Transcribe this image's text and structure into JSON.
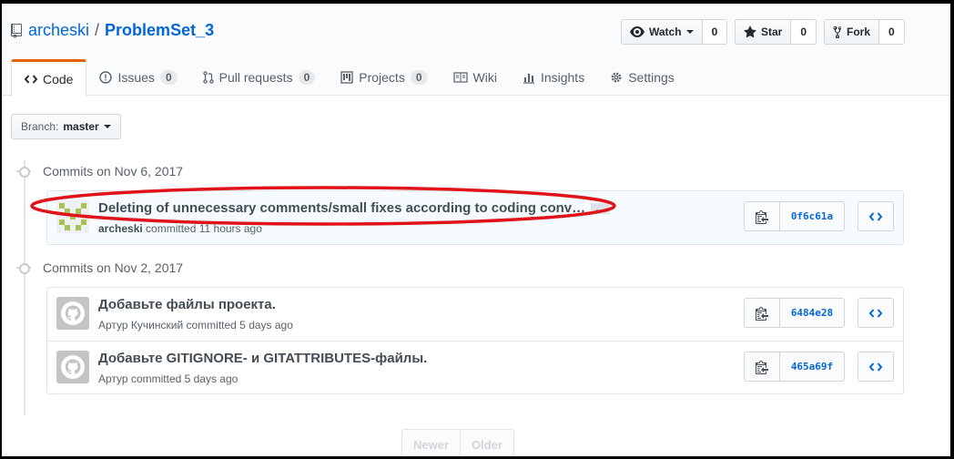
{
  "header": {
    "owner": "archeski",
    "separator": "/",
    "repo": "ProblemSet_3",
    "watch": {
      "label": "Watch",
      "count": "0"
    },
    "star": {
      "label": "Star",
      "count": "0"
    },
    "fork": {
      "label": "Fork",
      "count": "0"
    }
  },
  "tabs": [
    {
      "label": "Code",
      "icon": "code-icon"
    },
    {
      "label": "Issues",
      "count": "0",
      "icon": "issue-icon"
    },
    {
      "label": "Pull requests",
      "count": "0",
      "icon": "pull-request-icon"
    },
    {
      "label": "Projects",
      "count": "0",
      "icon": "project-icon"
    },
    {
      "label": "Wiki",
      "icon": "book-icon"
    },
    {
      "label": "Insights",
      "icon": "graph-icon"
    },
    {
      "label": "Settings",
      "icon": "gear-icon"
    }
  ],
  "branch": {
    "prefix": "Branch:",
    "name": "master"
  },
  "groups": [
    {
      "title": "Commits on Nov 6, 2017",
      "commits": [
        {
          "message": "Deleting of unnecessary comments/small fixes according to coding conv…",
          "ellipsis": "…",
          "author": "archeski",
          "time": "committed 11 hours ago",
          "sha": "0f6c61a"
        }
      ]
    },
    {
      "title": "Commits on Nov 2, 2017",
      "commits": [
        {
          "message": "Добавьте файлы проекта.",
          "author": "Артур Кучинский",
          "time": "committed 5 days ago",
          "sha": "6484e28"
        },
        {
          "message": "Добавьте GITIGNORE- и GITATTRIBUTES-файлы.",
          "author": "Артур",
          "time": "committed 5 days ago",
          "sha": "465a69f"
        }
      ]
    }
  ],
  "pagination": {
    "newer": "Newer",
    "older": "Older"
  },
  "colors": {
    "link": "#0366d6",
    "tab_accent": "#e36209",
    "annotation": "#e0121a"
  }
}
